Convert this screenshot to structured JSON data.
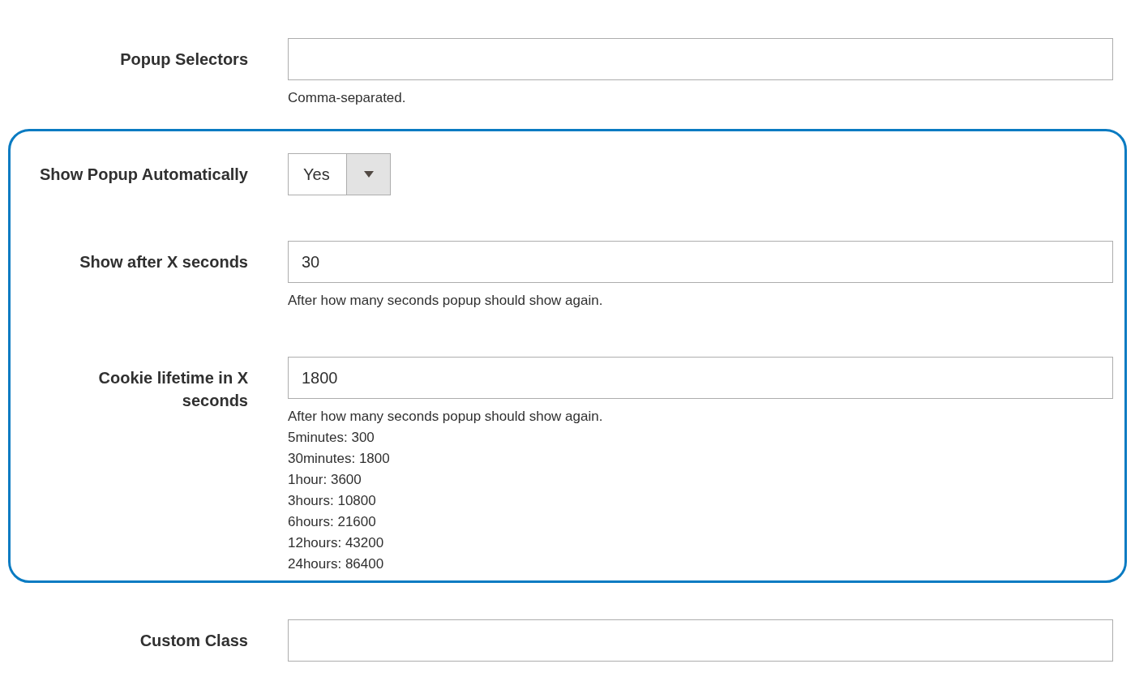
{
  "rows_before": [
    {
      "kind": "text",
      "label": "Popup Selectors",
      "notes": [
        "Comma-separated."
      ]
    }
  ],
  "highlighted": [
    {
      "kind": "select",
      "label": "Show Popup Automatically",
      "value": "Yes"
    },
    {
      "kind": "text",
      "label": "Show after X seconds",
      "value": "30",
      "notes": [
        "After how many seconds popup should show again."
      ]
    },
    {
      "kind": "text",
      "label": "Cookie lifetime in X seconds",
      "value": "1800",
      "notes": [
        "After how many seconds popup should show again.",
        "5minutes: 300",
        "30minutes: 1800",
        "1hour: 3600",
        "3hours: 10800",
        "6hours: 21600",
        "12hours: 43200",
        "24hours: 86400"
      ]
    }
  ],
  "rows_after": [
    {
      "kind": "text",
      "label": "Custom Class"
    }
  ]
}
